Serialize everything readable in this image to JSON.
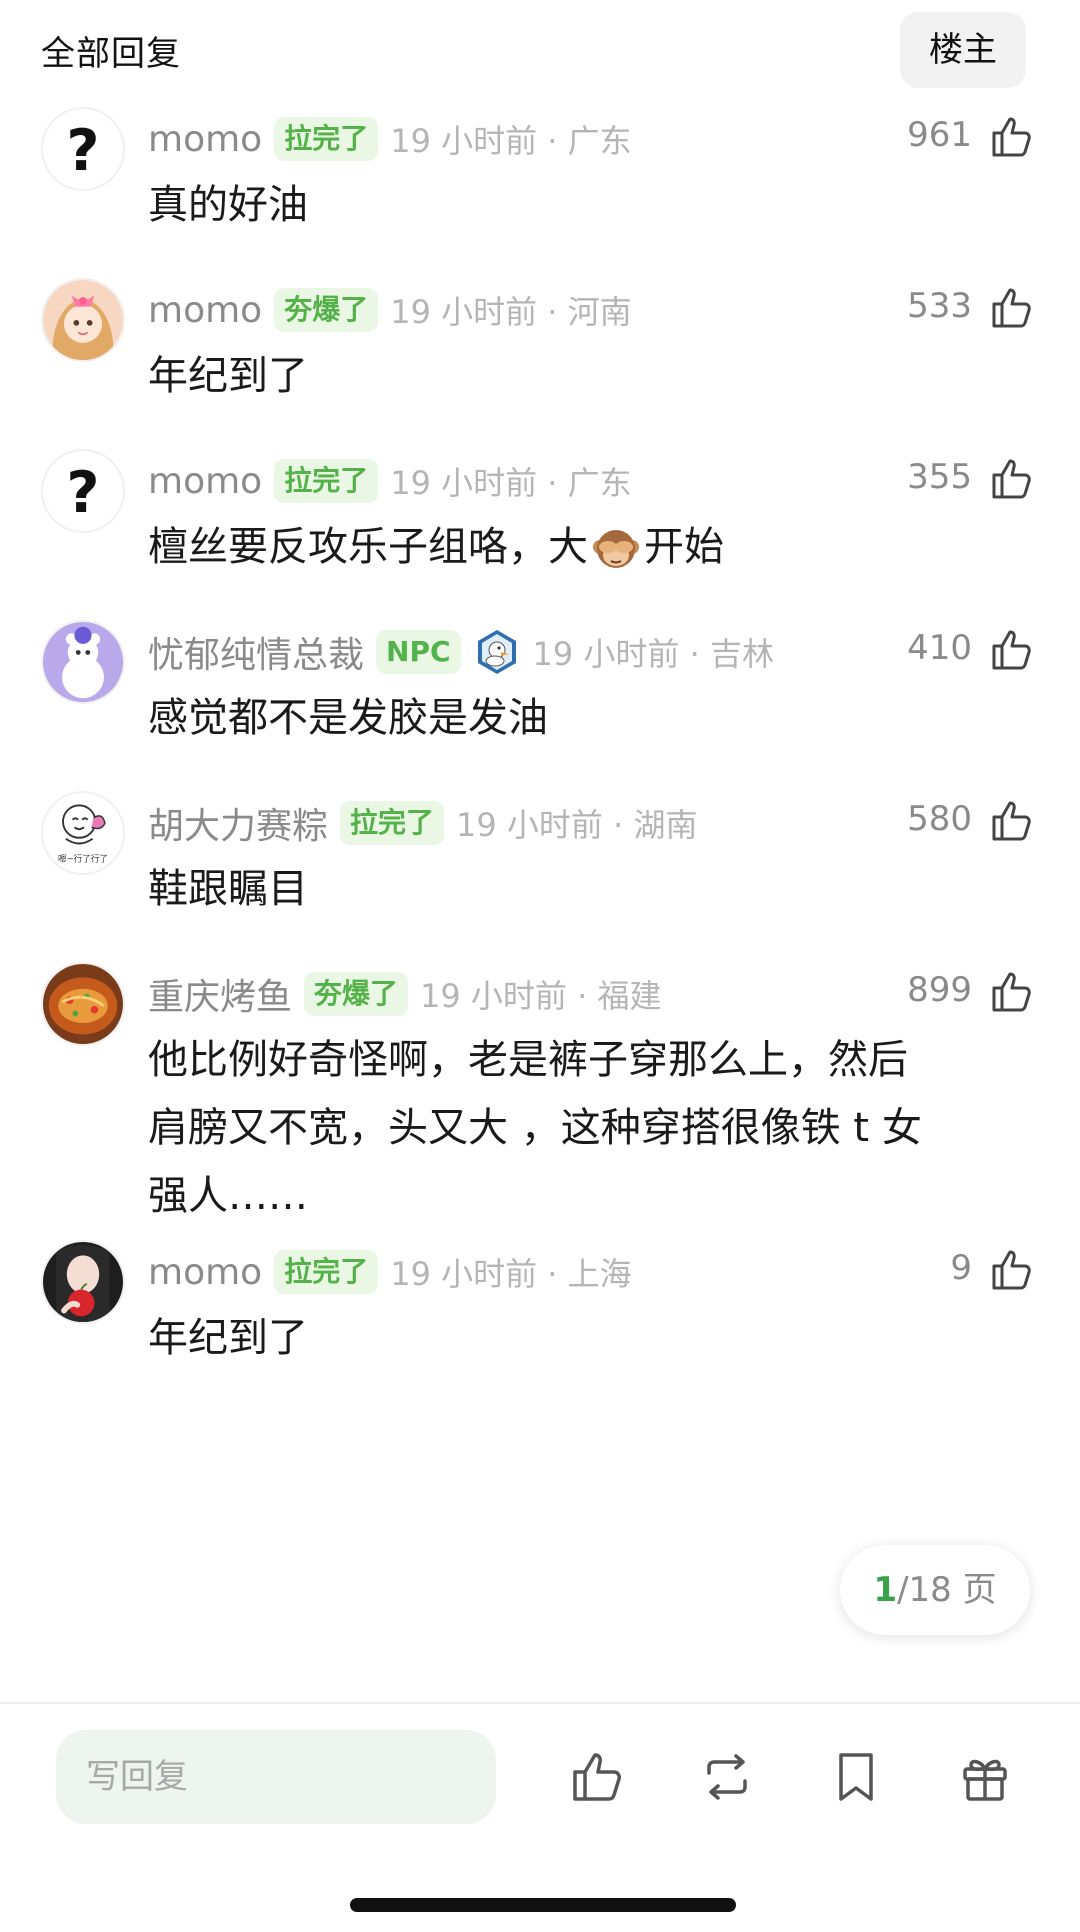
{
  "header": {
    "title": "全部回复",
    "op_filter": "楼主"
  },
  "comments": [
    {
      "username": "momo",
      "badge": "拉完了",
      "time": "19 小时前 · 广东",
      "likes": "961",
      "text": "真的好油",
      "avatar": "question-mark"
    },
    {
      "username": "momo",
      "badge": "夯爆了",
      "time": "19 小时前 · 河南",
      "likes": "533",
      "text": "年纪到了",
      "avatar": "anime-girl"
    },
    {
      "username": "momo",
      "badge": "拉完了",
      "time": "19 小时前 · 广东",
      "likes": "355",
      "text_before": "檀丝要反攻乐子组咯，大",
      "text_after": "开始",
      "emoji": "see-no-evil-monkey",
      "avatar": "question-mark"
    },
    {
      "username": "忧郁纯情总裁",
      "badge": "NPC",
      "medal": "duck-medal",
      "time": "19 小时前 · 吉林",
      "likes": "410",
      "text": "感觉都不是发胶是发油",
      "avatar": "purple-bear"
    },
    {
      "username": "胡大力赛粽",
      "badge": "拉完了",
      "time": "19 小时前 · 湖南",
      "likes": "580",
      "text": "鞋跟瞩目",
      "avatar": "cartoon-sticker",
      "avatar_caption": "嗯~行了行了"
    },
    {
      "username": "重庆烤鱼",
      "badge": "夯爆了",
      "time": "19 小时前 · 福建",
      "likes": "899",
      "text_lines": [
        "他比例好奇怪啊，老是裤子穿那么上，然后",
        "肩膀又不宽，头又大 ，这种穿搭很像铁 t 女",
        "强人……"
      ],
      "avatar": "grilled-fish"
    },
    {
      "username": "momo",
      "badge": "拉完了",
      "time": "19 小时前 · 上海",
      "likes": "9",
      "text": "年纪到了",
      "avatar": "girl-with-apple"
    }
  ],
  "pagination": {
    "current": "1",
    "total": "/18 页"
  },
  "bottom_bar": {
    "reply_placeholder": "写回复",
    "icons": [
      "like-icon",
      "repost-icon",
      "bookmark-icon",
      "gift-icon"
    ]
  },
  "colors": {
    "badge_bg": "#eaf7e4",
    "badge_text": "#55b24a",
    "accent": "#3ba14a"
  }
}
